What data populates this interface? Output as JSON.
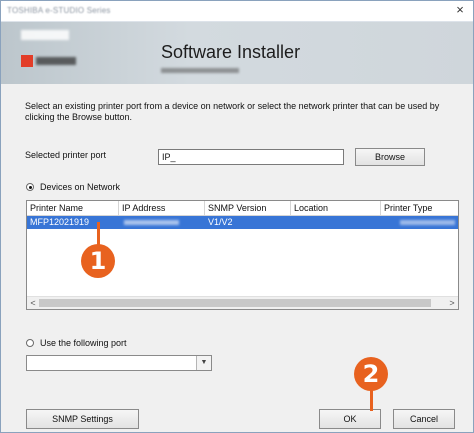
{
  "window": {
    "title": "TOSHIBA e-STUDIO Series",
    "close_glyph": "×"
  },
  "banner": {
    "title": "Software Installer",
    "brand": "TOSHIBA",
    "product": "e-STUDIO",
    "subtitle": "e-STUDIO Series"
  },
  "instructions": "Select an existing printer port from a device on network or select the network printer that can be used by clicking the Browse button.",
  "port": {
    "label": "Selected printer port",
    "value": "IP_",
    "browse_label": "Browse"
  },
  "devices": {
    "radio_label": "Devices on Network",
    "selected": true,
    "columns": [
      "Printer Name",
      "IP Address",
      "SNMP Version",
      "Location",
      "Printer Type"
    ],
    "rows": [
      {
        "printer_name": "MFP12021919",
        "ip_address": "",
        "snmp_version": "V1/V2",
        "location": "",
        "printer_type": ""
      }
    ]
  },
  "scroll": {
    "left_arrow": "<",
    "right_arrow": ">"
  },
  "following_port": {
    "radio_label": "Use the following port",
    "selected": false,
    "value": ""
  },
  "buttons": {
    "snmp_settings": "SNMP Settings",
    "ok": "OK",
    "cancel": "Cancel"
  },
  "callouts": {
    "one": "1",
    "two": "2"
  },
  "colors": {
    "selection": "#3875d6",
    "callout": "#e8621f",
    "brand_red": "#e23d28"
  }
}
